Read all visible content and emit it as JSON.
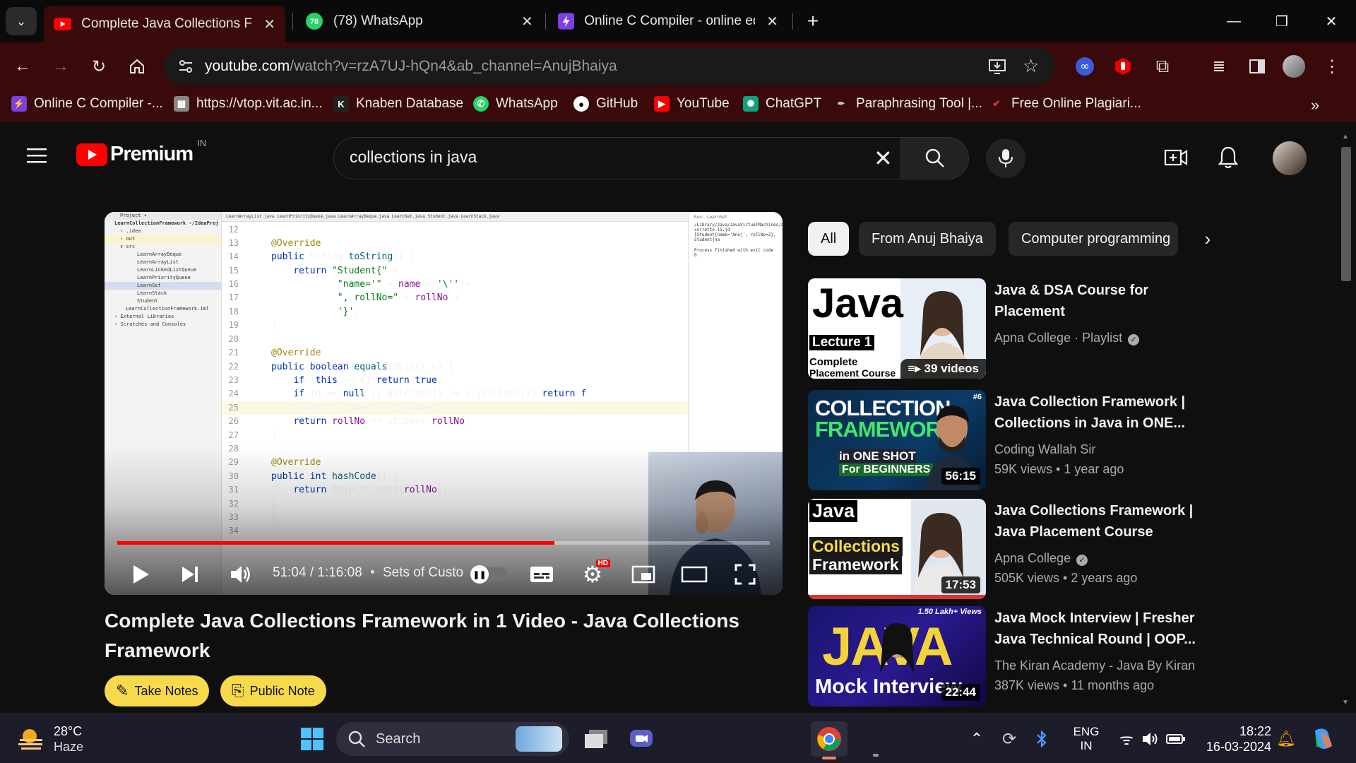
{
  "browser": {
    "tabs": [
      {
        "title": "Complete Java Collections Fram",
        "icon": "youtube-icon",
        "active": true
      },
      {
        "title": "(78) WhatsApp",
        "icon": "whatsapp-icon",
        "badge": "78",
        "active": false
      },
      {
        "title": "Online C Compiler - online edit",
        "icon": "compiler-icon",
        "active": false
      }
    ],
    "new_tab_label": "+",
    "url_host": "youtube.com",
    "url_path": "/watch?v=rzA7UJ-hQn4&ab_channel=AnujBhaiya",
    "bookmarks": [
      {
        "label": "Online C Compiler -...",
        "icon": "compiler-icon",
        "color": "#7b3fe4"
      },
      {
        "label": "https://vtop.vit.ac.in...",
        "icon": "vit-icon",
        "color": "#888888"
      },
      {
        "label": "Knaben Database",
        "icon": "knaben-icon",
        "color": "#222222"
      },
      {
        "label": "WhatsApp",
        "icon": "whatsapp-icon",
        "color": "#25d366"
      },
      {
        "label": "GitHub",
        "icon": "github-icon",
        "color": "#ffffff"
      },
      {
        "label": "YouTube",
        "icon": "youtube-icon",
        "color": "#ff0000"
      },
      {
        "label": "ChatGPT",
        "icon": "chatgpt-icon",
        "color": "#10a37f"
      },
      {
        "label": "Paraphrasing Tool |...",
        "icon": "quill-icon",
        "color": "#cccccc"
      },
      {
        "label": "Free Online Plagiari...",
        "icon": "check-icon",
        "color": "#e33"
      }
    ]
  },
  "youtube": {
    "logo_text": "Premium",
    "logo_region": "IN",
    "search_value": "collections in java",
    "video": {
      "title": "Complete Java Collections Framework in 1 Video - Java Collections Framework",
      "time": "51:04 / 1:16:08",
      "chapter": "Sets of Custo",
      "progress": 0.67,
      "settings_badge": "HD",
      "take_notes": "Take Notes",
      "public_note": "Public Note"
    },
    "chips": [
      {
        "label": "All",
        "selected": true
      },
      {
        "label": "From Anuj Bhaiya",
        "selected": false
      },
      {
        "label": "Computer programming",
        "selected": false
      }
    ],
    "recommendations": [
      {
        "title": "Java & DSA Course for Placement",
        "channel": "Apna College · Playlist",
        "meta": "",
        "badge": "39 videos",
        "thumb_text": [
          "Java",
          "Lecture 1",
          "Complete",
          "Placement Course"
        ],
        "verified": true
      },
      {
        "title": "Java Collection Framework | Collections in Java in ONE...",
        "channel": "Coding Wallah Sir",
        "meta": "59K views  • 1 year ago",
        "badge": "56:15",
        "thumb_text": [
          "COLLECTION",
          "FRAMEWORK",
          "in ONE SHOT",
          "For BEGINNERS",
          "#6"
        ],
        "verified": false
      },
      {
        "title": "Java Collections Framework | Java Placement Course",
        "channel": "Apna College",
        "meta": "505K views  • 2 years ago",
        "badge": "17:53",
        "thumb_text": [
          "Java",
          "Collections",
          "Framework"
        ],
        "verified": true
      },
      {
        "title": "Java Mock Interview | Fresher Java Technical Round | OOP...",
        "channel": "The Kiran Academy - Java By Kiran",
        "meta": "387K views  • 11 months ago",
        "badge": "22:44",
        "thumb_text": [
          "JAVA",
          "Mock Interview",
          "1.50 Lakh+ Views"
        ],
        "verified": false
      }
    ]
  },
  "ide": {
    "project_tree": [
      "Project ▾",
      "LearnCollectionFramework ~/IdeaProj",
      "› .idea",
      "› out",
      "∨ src",
      "LearnArrayDeque",
      "LearnArrayList",
      "LearnLinkedListQueue",
      "LearnPriorityQueue",
      "LearnSet",
      "LearnStack",
      "Student",
      "LearnCollectionFramework.iml",
      "› External Libraries",
      "› Scratches and Consoles"
    ],
    "editor_tabs": "LearnArrayList.java   LearnPriorityQueue.java   LearnArrayDeque.java   LearnSet.java   Student.java   LearnStack.java",
    "run_output": [
      "/Library/Java/JavaVirtualMachines/amazon-corretto-15.jd",
      "[Student{name='Anuj', rollNo=2}, Student{na",
      "",
      "Process finished with exit code 0"
    ],
    "run_label": "Run: LearnSet"
  },
  "taskbar": {
    "weather_temp": "28°C",
    "weather_desc": "Haze",
    "search_label": "Search",
    "lang_top": "ENG",
    "lang_bottom": "IN",
    "time": "18:22",
    "date": "16-03-2024"
  },
  "colors": {
    "youtube_red": "#ff0000",
    "browser_frame": "#3a0a0a",
    "page_bg": "#0f0f0f",
    "note_yellow": "#f7d94c"
  }
}
